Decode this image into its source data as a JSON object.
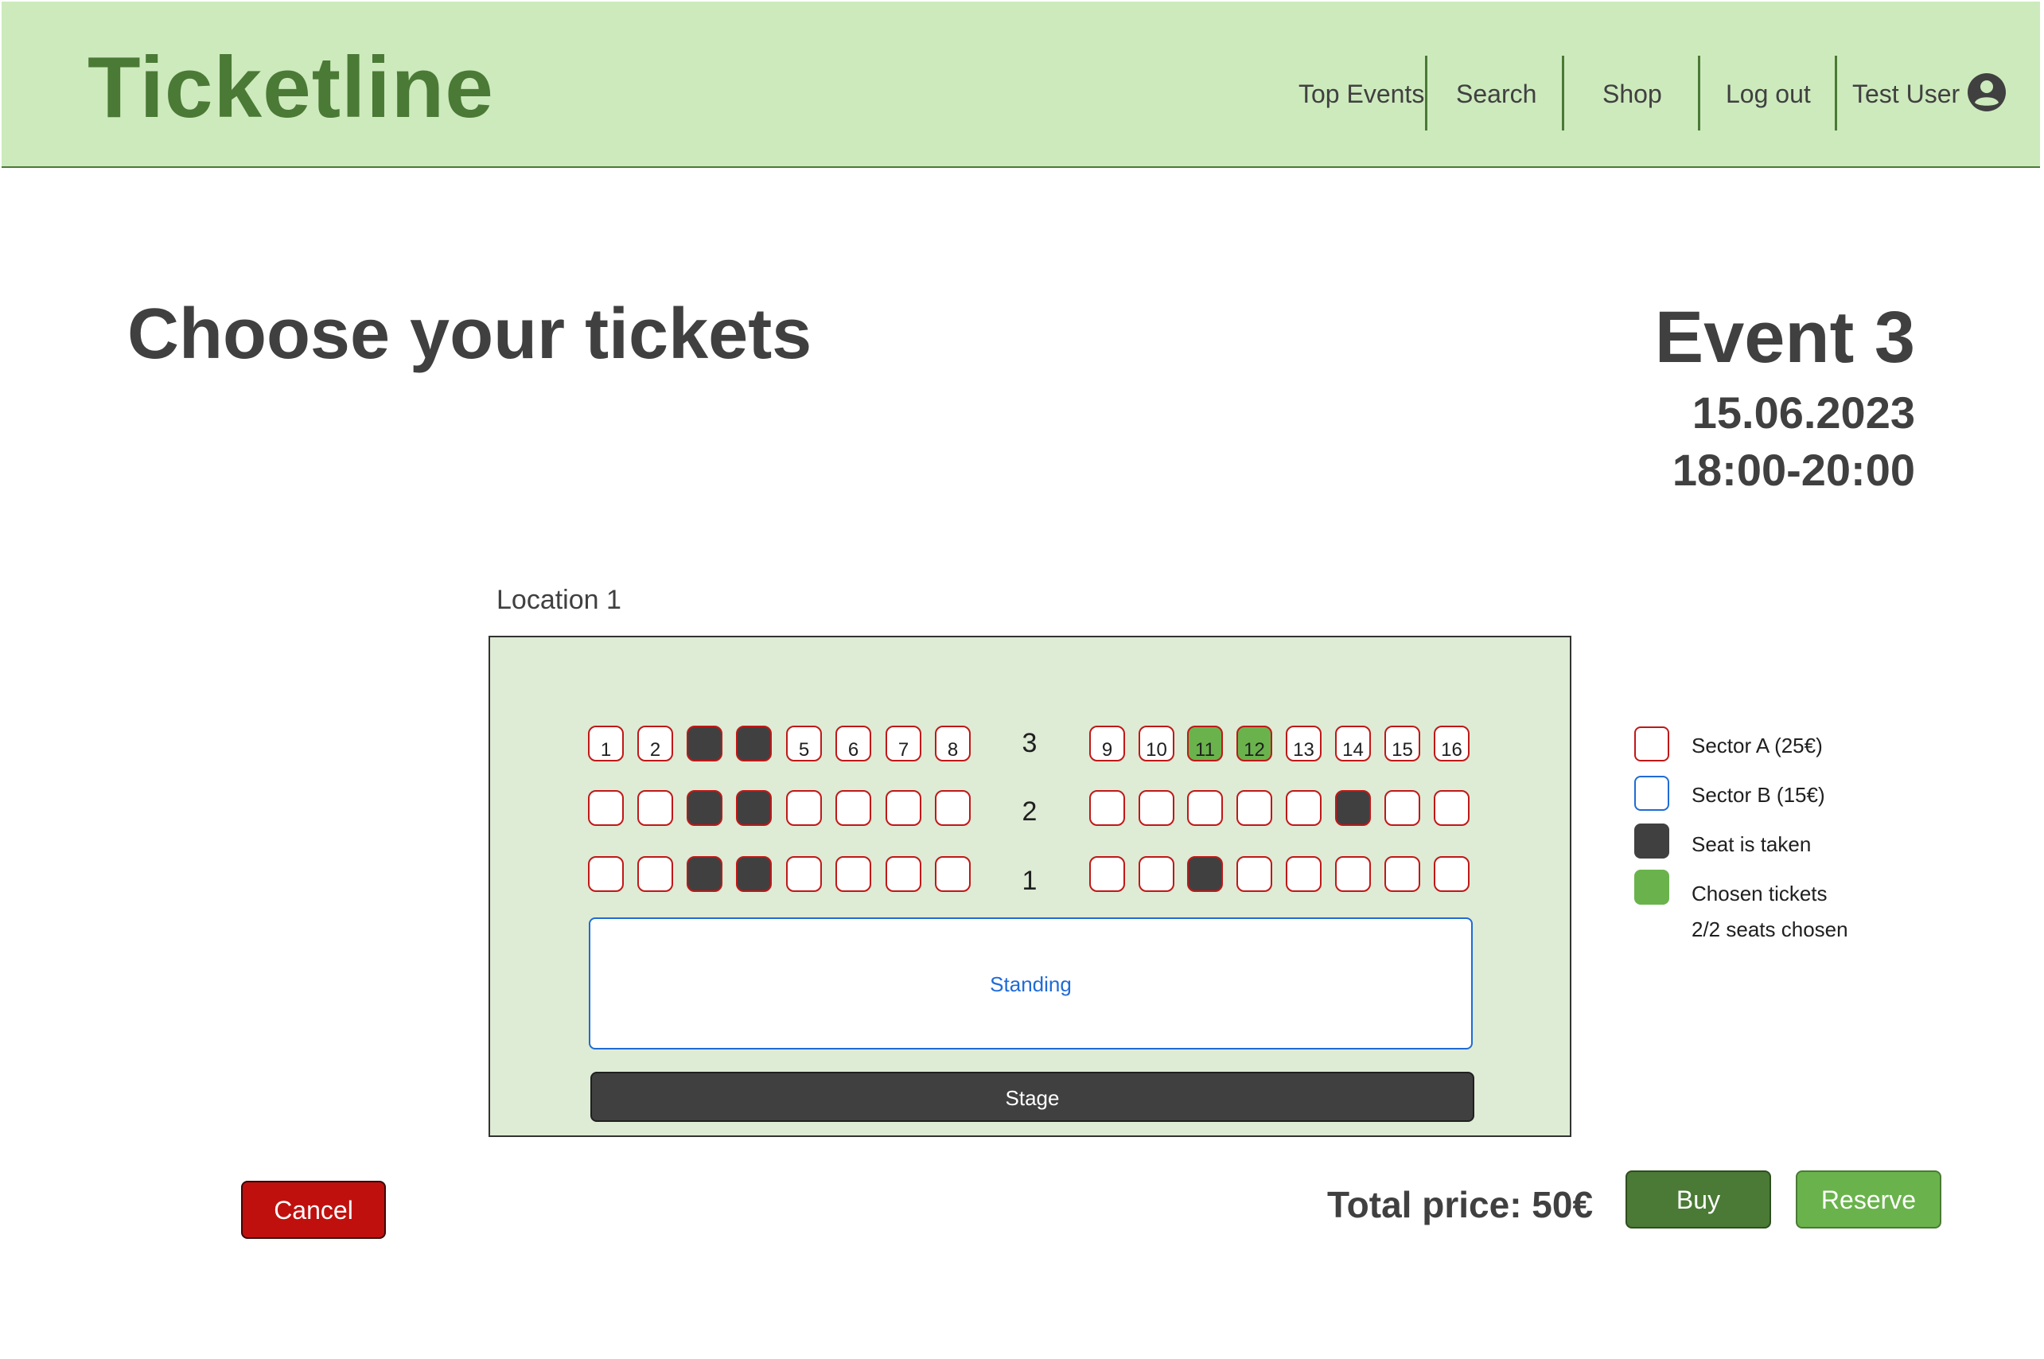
{
  "app": {
    "logo": "Ticketline"
  },
  "nav": {
    "items": [
      "Top Events",
      "Search",
      "Shop",
      "Log out"
    ],
    "user_name": "Test User"
  },
  "page": {
    "title": "Choose your tickets"
  },
  "event": {
    "name": "Event 3",
    "date": "15.06.2023",
    "time": "18:00-20:00"
  },
  "seat_map": {
    "location": "Location 1",
    "rows": [
      {
        "label": "3",
        "left_seats": [
          "1",
          "2",
          "",
          "",
          "5",
          "6",
          "7",
          "8"
        ],
        "right_seats": [
          "9",
          "10",
          "11",
          "12",
          "13",
          "14",
          "15",
          "16"
        ],
        "left_status": [
          "free",
          "free",
          "taken",
          "taken",
          "free",
          "free",
          "free",
          "free"
        ],
        "right_status": [
          "free",
          "free",
          "chosen",
          "chosen",
          "free",
          "free",
          "free",
          "free"
        ]
      },
      {
        "label": "2",
        "left_seats": [
          "",
          "",
          "",
          "",
          "",
          "",
          "",
          ""
        ],
        "right_seats": [
          "",
          "",
          "",
          "",
          "",
          "",
          "",
          ""
        ],
        "left_status": [
          "free",
          "free",
          "taken",
          "taken",
          "free",
          "free",
          "free",
          "free"
        ],
        "right_status": [
          "free",
          "free",
          "free",
          "free",
          "free",
          "taken",
          "free",
          "free"
        ]
      },
      {
        "label": "1",
        "left_seats": [
          "",
          "",
          "",
          "",
          "",
          "",
          "",
          ""
        ],
        "right_seats": [
          "",
          "",
          "",
          "",
          "",
          "",
          "",
          ""
        ],
        "left_status": [
          "free",
          "free",
          "taken",
          "taken",
          "free",
          "free",
          "free",
          "free"
        ],
        "right_status": [
          "free",
          "free",
          "taken",
          "free",
          "free",
          "free",
          "free",
          "free"
        ]
      }
    ],
    "standing_label": "Standing",
    "stage_label": "Stage"
  },
  "legend": {
    "sector_a": "Sector A (25€)",
    "sector_b": "Sector B (15€)",
    "taken": "Seat is taken",
    "chosen": "Chosen tickets",
    "seats_chosen": "2/2 seats chosen"
  },
  "colors": {
    "header_bg": "#cdeabd",
    "brand_green": "#4a7a35",
    "chosen_green": "#6ab34c",
    "taken_dark": "#404040",
    "sector_a_border": "#c01818",
    "sector_b_border": "#1f6bd6",
    "cancel_red": "#c0100e",
    "map_bg": "#deebd5"
  },
  "footer": {
    "cancel_label": "Cancel",
    "total_price": "Total price: 50€",
    "buy_label": "Buy",
    "reserve_label": "Reserve"
  }
}
